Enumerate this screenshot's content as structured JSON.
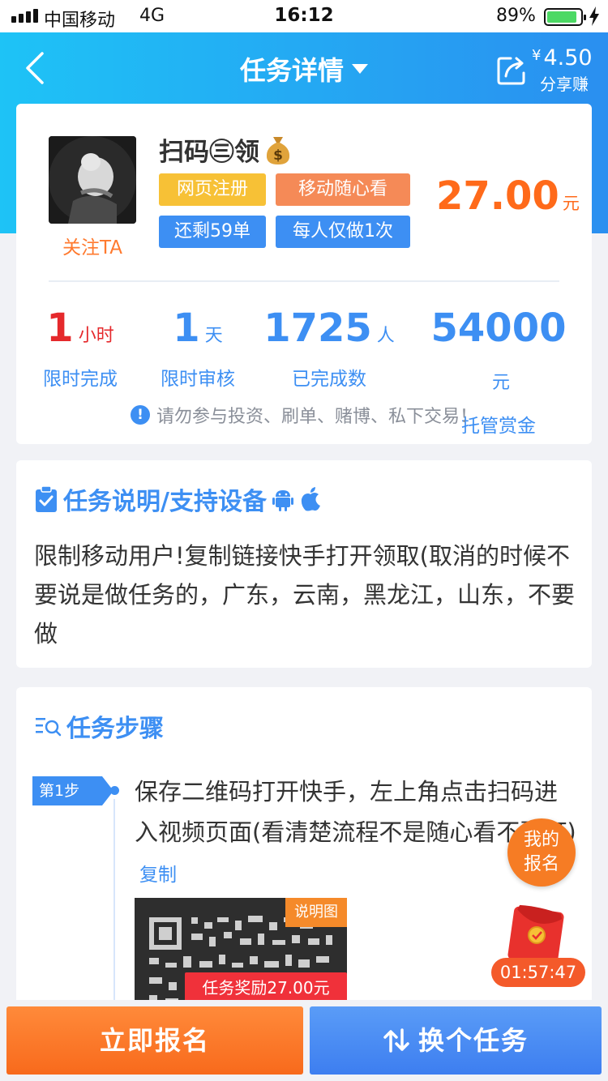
{
  "status_bar": {
    "carrier": "中国移动",
    "network": "4G",
    "time": "16:12",
    "battery": "89%",
    "battery_level": 0.89
  },
  "nav": {
    "title": "任务详情",
    "share_currency": "¥",
    "share_amount": "4.50",
    "share_label": "分享赚"
  },
  "task": {
    "follow_label": "关注TA",
    "name": "扫码㊂领",
    "tags": [
      "网页注册",
      "移动随心看",
      "还剩59单",
      "每人仅做1次"
    ],
    "price": "27.00",
    "price_unit": "元",
    "stats": [
      {
        "value": "1",
        "unit": "小时",
        "label": "限时完成"
      },
      {
        "value": "1",
        "unit": "天",
        "label": "限时审核"
      },
      {
        "value": "1725",
        "unit": "人",
        "label": "已完成数"
      },
      {
        "value": "54000",
        "unit": "元",
        "label": "托管赏金"
      }
    ],
    "warning": "请勿参与投资、刷单、赌博、私下交易！"
  },
  "description": {
    "title": "任务说明/支持设备",
    "text": "限制移动用户!复制链接快手打开领取(取消的时候不要说是做任务的，广东，云南，黑龙江，山东，不要做"
  },
  "steps": {
    "title": "任务步骤",
    "items": [
      {
        "badge": "第1步",
        "text": "保存二维码打开快手，左上角点击扫码进入视频页面(看清楚流程不是随心看不要订)",
        "copy_label": "复制",
        "image_label": "说明图"
      }
    ]
  },
  "floating": {
    "my_signup_line1": "我的",
    "my_signup_line2": "报名",
    "timer": "01:57:47",
    "reward": "任务奖励27.00元"
  },
  "bottom": {
    "signup": "立即报名",
    "switch": "换个任务"
  },
  "colors": {
    "primary_blue": "#3d8ff3",
    "orange": "#ff6a1a",
    "red": "#e5292c"
  }
}
